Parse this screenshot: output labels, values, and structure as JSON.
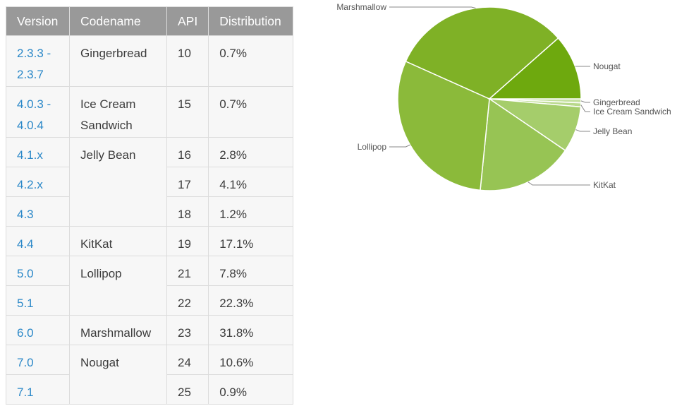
{
  "table": {
    "headers": [
      "Version",
      "Codename",
      "API",
      "Distribution"
    ],
    "rows": [
      {
        "version": "2.3.3 - 2.3.7",
        "version_lines": [
          "2.3.3 -",
          "2.3.7"
        ],
        "codename": "Gingerbread",
        "codename_lines": [
          "Gingerbread"
        ],
        "api": "10",
        "distribution": "0.7%"
      },
      {
        "version": "4.0.3 - 4.0.4",
        "version_lines": [
          "4.0.3 -",
          "4.0.4"
        ],
        "codename": "Ice Cream Sandwich",
        "codename_lines": [
          "Ice Cream",
          "Sandwich"
        ],
        "api": "15",
        "distribution": "0.7%"
      },
      {
        "version": "4.1.x",
        "codename": "Jelly Bean",
        "api": "16",
        "distribution": "2.8%"
      },
      {
        "version": "4.2.x",
        "codename": "",
        "api": "17",
        "distribution": "4.1%"
      },
      {
        "version": "4.3",
        "codename": "",
        "api": "18",
        "distribution": "1.2%"
      },
      {
        "version": "4.4",
        "codename": "KitKat",
        "api": "19",
        "distribution": "17.1%"
      },
      {
        "version": "5.0",
        "codename": "Lollipop",
        "api": "21",
        "distribution": "7.8%"
      },
      {
        "version": "5.1",
        "codename": "",
        "api": "22",
        "distribution": "22.3%"
      },
      {
        "version": "6.0",
        "codename": "Marshmallow",
        "api": "23",
        "distribution": "31.8%"
      },
      {
        "version": "7.0",
        "codename": "Nougat",
        "api": "24",
        "distribution": "10.6%"
      },
      {
        "version": "7.1",
        "codename": "",
        "api": "25",
        "distribution": "0.9%"
      }
    ]
  },
  "chart_data": {
    "type": "pie",
    "title": "",
    "labels": [
      "Gingerbread",
      "Ice Cream Sandwich",
      "Jelly Bean",
      "KitKat",
      "Lollipop",
      "Marshmallow",
      "Nougat"
    ],
    "values": [
      0.7,
      0.7,
      8.1,
      17.1,
      30.1,
      31.8,
      11.5
    ],
    "colors": [
      "#c5e0a0",
      "#b9d98c",
      "#a5cd6b",
      "#97c454",
      "#8bba3a",
      "#7fb126",
      "#6ea90e"
    ],
    "start": "3 o'clock, clockwise",
    "legend": "leader-line labels"
  }
}
